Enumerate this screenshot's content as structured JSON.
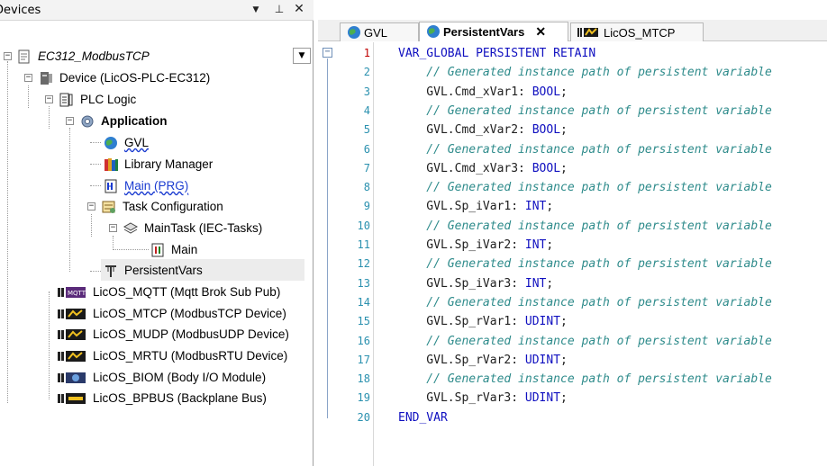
{
  "devices_panel": {
    "title": "Devices",
    "collapse_glyph": "▼",
    "pin_glyph": "⊥",
    "close_glyph": "✕"
  },
  "tree": {
    "root": "EC312_ModbusTCP",
    "device": "Device (LicOS-PLC-EC312)",
    "plc_logic": "PLC Logic",
    "application": "Application",
    "gvl": "GVL",
    "library_manager": "Library Manager",
    "main_prg": "Main (PRG)",
    "task_configuration": "Task Configuration",
    "main_task": "MainTask (IEC-Tasks)",
    "main": "Main",
    "persistent_vars": "PersistentVars",
    "modules": [
      {
        "label": "LicOS_MQTT (Mqtt Brok Sub Pub)",
        "icon": "mqtt-icon"
      },
      {
        "label": "LicOS_MTCP (ModbusTCP Device)",
        "icon": "modbus-icon"
      },
      {
        "label": "LicOS_MUDP (ModbusUDP Device)",
        "icon": "modbus-icon"
      },
      {
        "label": "LicOS_MRTU (ModbusRTU Device)",
        "icon": "modbus-icon"
      },
      {
        "label": "LicOS_BIOM (Body I/O Module)",
        "icon": "io-module-icon"
      },
      {
        "label": "LicOS_BPBUS (Backplane Bus)",
        "icon": "backplane-icon"
      }
    ]
  },
  "tabs": [
    {
      "label": "GVL",
      "icon": "globe-icon",
      "active": false
    },
    {
      "label": "PersistentVars",
      "icon": "globe-icon",
      "active": true,
      "close": "✕"
    },
    {
      "label": "LicOS_MTCP",
      "icon": "modbus-icon",
      "active": false
    }
  ],
  "editor": {
    "fold_glyph": "−",
    "lines": [
      {
        "n": "1",
        "parts": [
          {
            "t": "VAR_GLOBAL PERSISTENT RETAIN",
            "c": "kw"
          }
        ]
      },
      {
        "n": "2",
        "parts": [
          {
            "t": "    // Generated instance path of persistent variable",
            "c": "cm"
          }
        ]
      },
      {
        "n": "3",
        "parts": [
          {
            "t": "    GVL.Cmd_xVar1: ",
            "c": "id"
          },
          {
            "t": "BOOL",
            "c": "kw"
          },
          {
            "t": ";",
            "c": "id"
          }
        ]
      },
      {
        "n": "4",
        "parts": [
          {
            "t": "    // Generated instance path of persistent variable",
            "c": "cm"
          }
        ]
      },
      {
        "n": "5",
        "parts": [
          {
            "t": "    GVL.Cmd_xVar2: ",
            "c": "id"
          },
          {
            "t": "BOOL",
            "c": "kw"
          },
          {
            "t": ";",
            "c": "id"
          }
        ]
      },
      {
        "n": "6",
        "parts": [
          {
            "t": "    // Generated instance path of persistent variable",
            "c": "cm"
          }
        ]
      },
      {
        "n": "7",
        "parts": [
          {
            "t": "    GVL.Cmd_xVar3: ",
            "c": "id"
          },
          {
            "t": "BOOL",
            "c": "kw"
          },
          {
            "t": ";",
            "c": "id"
          }
        ]
      },
      {
        "n": "8",
        "parts": [
          {
            "t": "    // Generated instance path of persistent variable",
            "c": "cm"
          }
        ]
      },
      {
        "n": "9",
        "parts": [
          {
            "t": "    GVL.Sp_iVar1: ",
            "c": "id"
          },
          {
            "t": "INT",
            "c": "kw"
          },
          {
            "t": ";",
            "c": "id"
          }
        ]
      },
      {
        "n": "10",
        "parts": [
          {
            "t": "    // Generated instance path of persistent variable",
            "c": "cm"
          }
        ]
      },
      {
        "n": "11",
        "parts": [
          {
            "t": "    GVL.Sp_iVar2: ",
            "c": "id"
          },
          {
            "t": "INT",
            "c": "kw"
          },
          {
            "t": ";",
            "c": "id"
          }
        ]
      },
      {
        "n": "12",
        "parts": [
          {
            "t": "    // Generated instance path of persistent variable",
            "c": "cm"
          }
        ]
      },
      {
        "n": "13",
        "parts": [
          {
            "t": "    GVL.Sp_iVar3: ",
            "c": "id"
          },
          {
            "t": "INT",
            "c": "kw"
          },
          {
            "t": ";",
            "c": "id"
          }
        ]
      },
      {
        "n": "14",
        "parts": [
          {
            "t": "    // Generated instance path of persistent variable",
            "c": "cm"
          }
        ]
      },
      {
        "n": "15",
        "parts": [
          {
            "t": "    GVL.Sp_rVar1: ",
            "c": "id"
          },
          {
            "t": "UDINT",
            "c": "kw"
          },
          {
            "t": ";",
            "c": "id"
          }
        ]
      },
      {
        "n": "16",
        "parts": [
          {
            "t": "    // Generated instance path of persistent variable",
            "c": "cm"
          }
        ]
      },
      {
        "n": "17",
        "parts": [
          {
            "t": "    GVL.Sp_rVar2: ",
            "c": "id"
          },
          {
            "t": "UDINT",
            "c": "kw"
          },
          {
            "t": ";",
            "c": "id"
          }
        ]
      },
      {
        "n": "18",
        "parts": [
          {
            "t": "    // Generated instance path of persistent variable",
            "c": "cm"
          }
        ]
      },
      {
        "n": "19",
        "parts": [
          {
            "t": "    GVL.Sp_rVar3: ",
            "c": "id"
          },
          {
            "t": "UDINT",
            "c": "kw"
          },
          {
            "t": ";",
            "c": "id"
          }
        ]
      },
      {
        "n": "20",
        "parts": [
          {
            "t": "END_VAR",
            "c": "kw"
          }
        ]
      }
    ]
  }
}
